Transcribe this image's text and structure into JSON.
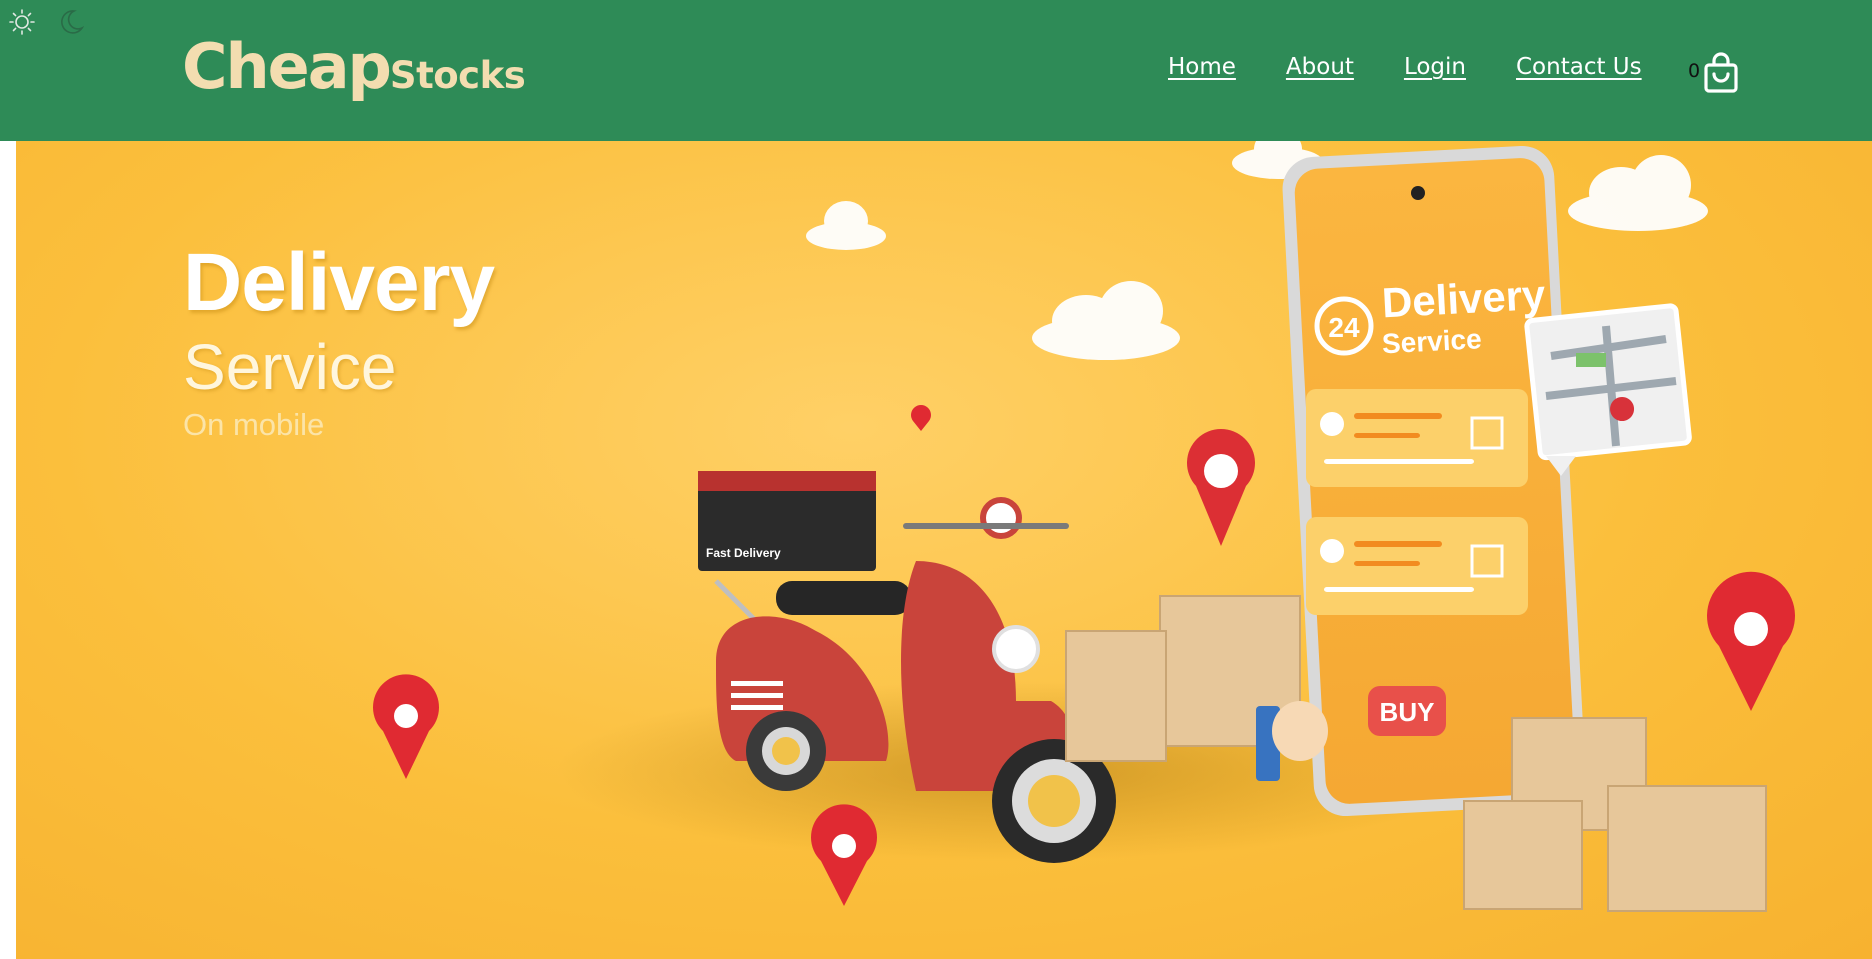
{
  "header": {
    "brand_big": "Cheap",
    "brand_small": "Stocks",
    "nav": [
      "Home",
      "About",
      "Login",
      "Contact Us"
    ],
    "cart_count": "0",
    "colors": {
      "header_bg": "#2e8b57",
      "brand": "#f3ddb0",
      "nav_text": "#ffffff"
    },
    "theme_icons": [
      "sun-icon",
      "moon-icon"
    ]
  },
  "hero": {
    "headline": "Delivery",
    "subheadline": "Service",
    "tagline": "On mobile",
    "phone_title": "Delivery",
    "phone_subtitle": "Service",
    "phone_badge": "24",
    "buy_label": "BUY",
    "box_label": "Fast Delivery",
    "colors": {
      "background": "#fbbf3c"
    }
  }
}
